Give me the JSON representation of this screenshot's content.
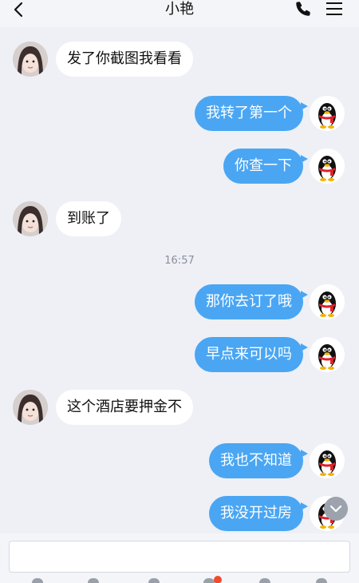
{
  "header": {
    "title": "小艳"
  },
  "messages": [
    {
      "side": "in",
      "text": "发了你截图我看看"
    },
    {
      "side": "out",
      "text": "我转了第一个"
    },
    {
      "side": "out",
      "text": "你查一下"
    },
    {
      "side": "in",
      "text": "到账了"
    },
    {
      "side": "time",
      "text": "16:57"
    },
    {
      "side": "out",
      "text": "那你去订了哦"
    },
    {
      "side": "out",
      "text": "早点来可以吗"
    },
    {
      "side": "in",
      "text": "这个酒店要押金不"
    },
    {
      "side": "out",
      "text": "我也不知道"
    },
    {
      "side": "out",
      "text": "我没开过房"
    }
  ],
  "input": {
    "value": ""
  },
  "colors": {
    "bubble_out": "#4aa6f3",
    "bubble_in": "#ffffff",
    "background": "#eef0f6"
  },
  "icons": [
    "back-arrow-icon",
    "phone-icon",
    "menu-icon",
    "scroll-down-icon",
    "girl-avatar",
    "qq-penguin-avatar"
  ]
}
